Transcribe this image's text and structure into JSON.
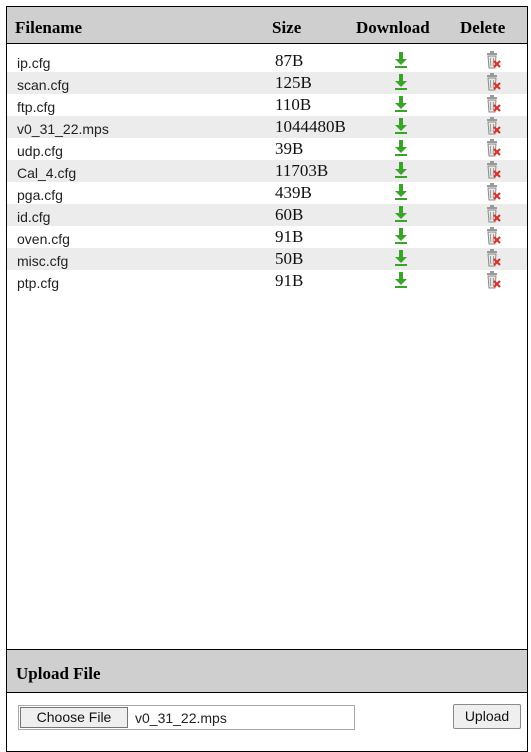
{
  "columns": {
    "filename": "Filename",
    "size": "Size",
    "download": "Download",
    "delete": "Delete"
  },
  "files": [
    {
      "name": "ip.cfg",
      "size": "87B"
    },
    {
      "name": "scan.cfg",
      "size": "125B"
    },
    {
      "name": "ftp.cfg",
      "size": "110B"
    },
    {
      "name": "v0_31_22.mps",
      "size": "1044480B"
    },
    {
      "name": "udp.cfg",
      "size": "39B"
    },
    {
      "name": "Cal_4.cfg",
      "size": "11703B"
    },
    {
      "name": "pga.cfg",
      "size": "439B"
    },
    {
      "name": "id.cfg",
      "size": "60B"
    },
    {
      "name": "oven.cfg",
      "size": "91B"
    },
    {
      "name": "misc.cfg",
      "size": "50B"
    },
    {
      "name": "ptp.cfg",
      "size": "91B"
    }
  ],
  "row_icons": {
    "download": "download-arrow-icon",
    "delete": "trash-delete-icon"
  },
  "colors": {
    "header_bg": "#cfcfcf",
    "row_alt_bg": "#ececec",
    "download_green": "#3aa32a",
    "delete_red": "#d9342b"
  },
  "upload": {
    "section_title": "Upload File",
    "choose_label": "Choose File",
    "chosen_file": "v0_31_22.mps",
    "upload_label": "Upload"
  }
}
